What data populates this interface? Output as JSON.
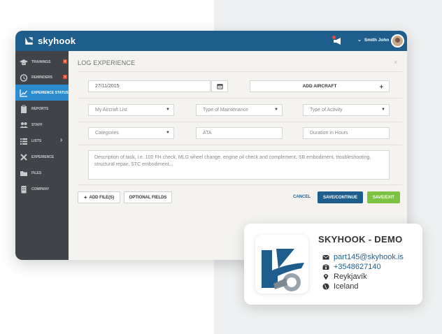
{
  "app": {
    "brand": "skyhook",
    "user_name": "Smith John"
  },
  "sidebar": {
    "items": [
      {
        "label": "TRAININGS",
        "badge": "5",
        "icon": "graduation-cap-icon"
      },
      {
        "label": "REMINDERS",
        "badge": "2",
        "icon": "alarm-clock-icon"
      },
      {
        "label": "EXPERIENCE STATUS",
        "icon": "chart-icon",
        "active": true
      },
      {
        "label": "REPORTS",
        "icon": "clipboard-icon"
      },
      {
        "label": "STAFF",
        "icon": "users-icon"
      },
      {
        "label": "LISTS",
        "icon": "list-icon"
      },
      {
        "label": "EXPERIENCE",
        "icon": "tools-icon"
      },
      {
        "label": "FILES",
        "icon": "folder-icon"
      },
      {
        "label": "COMPANY",
        "icon": "building-icon"
      }
    ]
  },
  "form": {
    "title": "LOG EXPERIENCE",
    "date_value": "27/11/2015",
    "add_aircraft_label": "ADD AIRCRAFT",
    "aircraft_list": "My Aircraft List",
    "maintenance_type": "Type of Maintenance",
    "activity_type": "Type of Activity",
    "categories": "Categories",
    "ata_placeholder": "ATA",
    "duration_placeholder": "Duration in Hours",
    "description_placeholder": "Description of task, i.e. 100 FH check, MLG wheel change, engine oil check and complement, SB embodiment, troubleshooting, structural repair, STC embodiment...",
    "add_files_label": "ADD FILE(S)",
    "optional_fields_label": "OPTIONAL FIELDS",
    "cancel_label": "CANCEL",
    "save_continue_label": "SAVE/CONTINUE",
    "save_exit_label": "SAVE/EXIT"
  },
  "contact_card": {
    "title": "SKYHOOK - DEMO",
    "email": "part145@skyhook.is",
    "phone": "+3548627140",
    "city": "Reykjavík",
    "country": "Iceland"
  },
  "colors": {
    "header_blue": "#1f5e8c",
    "sidebar_dark": "#404448",
    "active_blue": "#2d8ccd",
    "badge_red": "#e74c3c",
    "save_continue": "#1f5e8c",
    "save_exit": "#7dc242"
  }
}
